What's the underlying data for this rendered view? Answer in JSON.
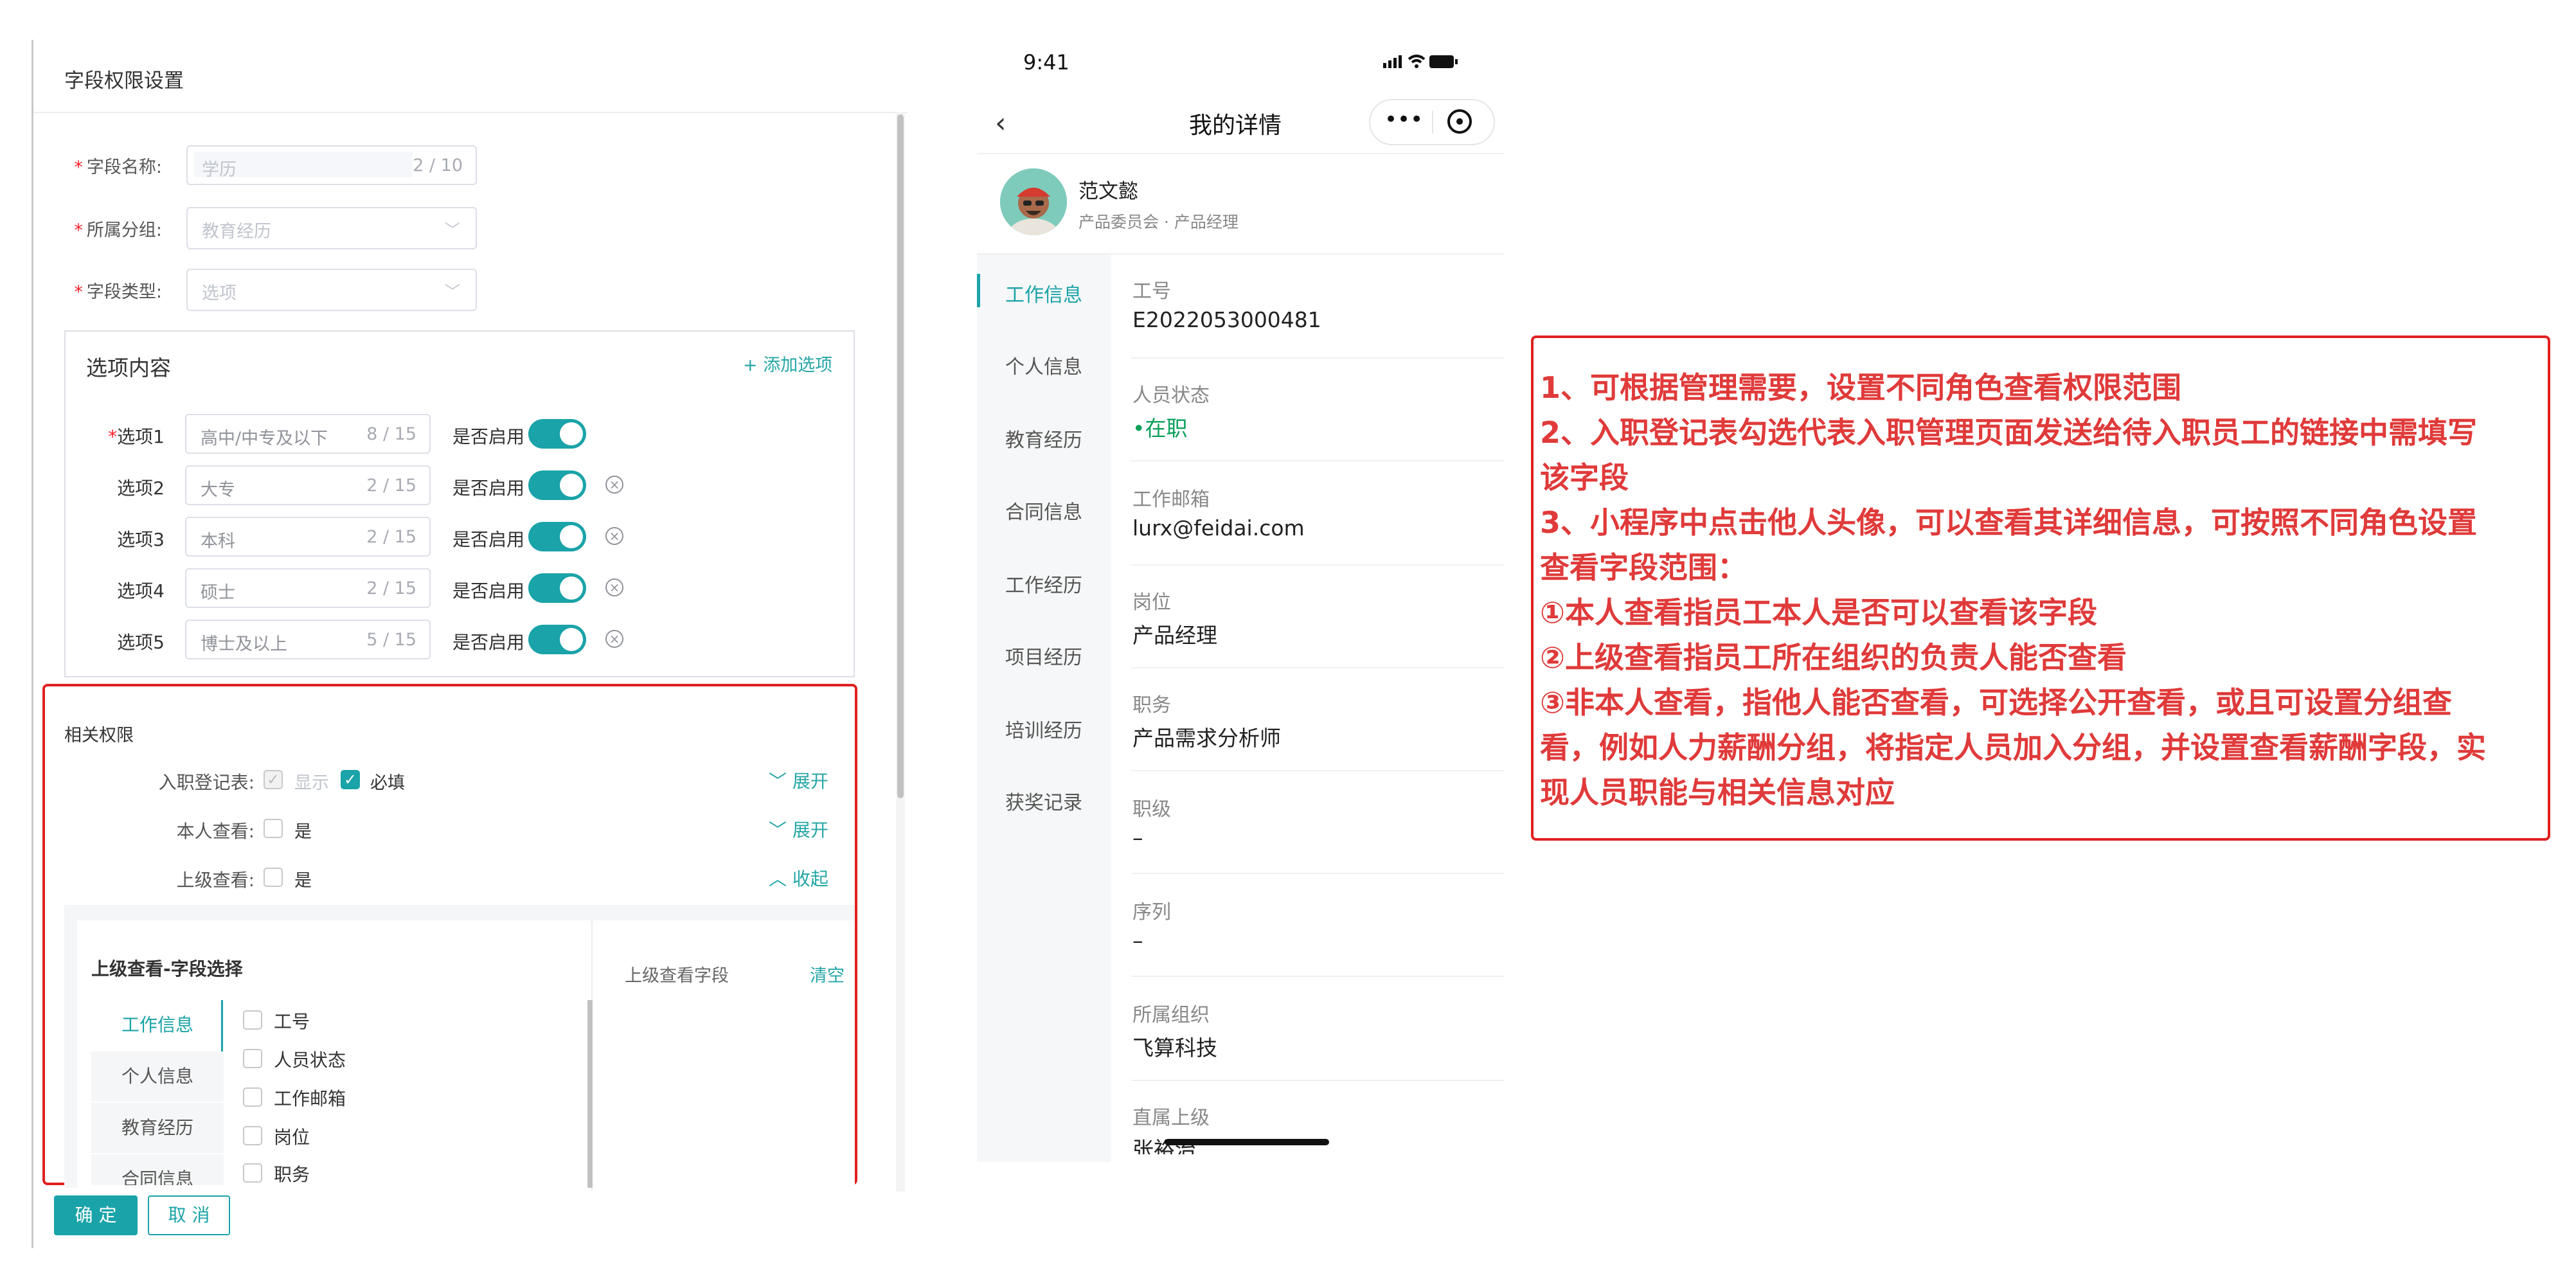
{
  "left_panel": {
    "title": "字段权限设置",
    "form": {
      "field_name": {
        "label": "字段名称:",
        "placeholder": "学历",
        "count": "2 / 10"
      },
      "group": {
        "label": "所属分组:",
        "placeholder": "教育经历"
      },
      "field_type": {
        "label": "字段类型:",
        "placeholder": "选项"
      }
    },
    "options": {
      "title": "选项内容",
      "add_label": "+ 添加选项",
      "enable_label": "是否启用",
      "items": [
        {
          "label": "选项1",
          "value": "高中/中专及以下",
          "count": "8 / 15",
          "enabled": true
        },
        {
          "label": "选项2",
          "value": "大专",
          "count": "2 / 15",
          "enabled": true
        },
        {
          "label": "选项3",
          "value": "本科",
          "count": "2 / 15",
          "enabled": true
        },
        {
          "label": "选项4",
          "value": "硕士",
          "count": "2 / 15",
          "enabled": true
        },
        {
          "label": "选项5",
          "value": "博士及以上",
          "count": "5 / 15",
          "enabled": true
        }
      ]
    },
    "permissions": {
      "title": "相关权限",
      "onboarding": {
        "label": "入职登记表:",
        "show_label": "显示",
        "required_label": "必填",
        "toggle": "展开"
      },
      "self_view": {
        "label": "本人查看:",
        "option": "是",
        "toggle": "展开"
      },
      "superior_view": {
        "label": "上级查看:",
        "option": "是",
        "toggle": "收起"
      }
    },
    "field_select": {
      "title": "上级查看-字段选择",
      "right_title": "上级查看字段",
      "clear_label": "清空",
      "categories": [
        "工作信息",
        "个人信息",
        "教育经历",
        "合同信息"
      ],
      "fields": [
        "工号",
        "人员状态",
        "工作邮箱",
        "岗位",
        "职务"
      ]
    },
    "buttons": {
      "confirm": "确 定",
      "cancel": "取 消"
    }
  },
  "mobile": {
    "status_time": "9:41",
    "nav_title": "我的详情",
    "profile": {
      "name": "范文懿",
      "dept": "产品委员会 · 产品经理"
    },
    "side_nav": [
      "工作信息",
      "个人信息",
      "教育经历",
      "合同信息",
      "工作经历",
      "项目经历",
      "培训经历",
      "获奖记录"
    ],
    "info": [
      {
        "label": "工号",
        "value": "E2022053000481"
      },
      {
        "label": "人员状态",
        "value": "在职"
      },
      {
        "label": "工作邮箱",
        "value": "lurx@feidai.com"
      },
      {
        "label": "岗位",
        "value": "产品经理"
      },
      {
        "label": "职务",
        "value": "产品需求分析师"
      },
      {
        "label": "职级",
        "value": "–"
      },
      {
        "label": "序列",
        "value": "–"
      },
      {
        "label": "所属组织",
        "value": "飞算科技"
      },
      {
        "label": "直属上级",
        "value": "张裕治"
      }
    ]
  },
  "annotation": {
    "lines": [
      "1、可根据管理需要，设置不同角色查看权限范围",
      "2、入职登记表勾选代表入职管理页面发送给待入职员工的链接中需填写",
      "该字段",
      "3、小程序中点击他人头像，可以查看其详细信息，可按照不同角色设置",
      "查看字段范围：",
      "①本人查看指员工本人是否可以查看该字段",
      "②上级查看指员工所在组织的负责人能否查看",
      "③非本人查看，指他人能否查看，可选择公开查看，或且可设置分组查",
      "看，例如人力薪酬分组，将指定人员加入分组，并设置查看薪酬字段，实",
      "现人员职能与相关信息对应"
    ]
  },
  "colors": {
    "accent": "#1aa3a8",
    "annotation_red": "#e02020",
    "status_green": "#07a05a"
  }
}
